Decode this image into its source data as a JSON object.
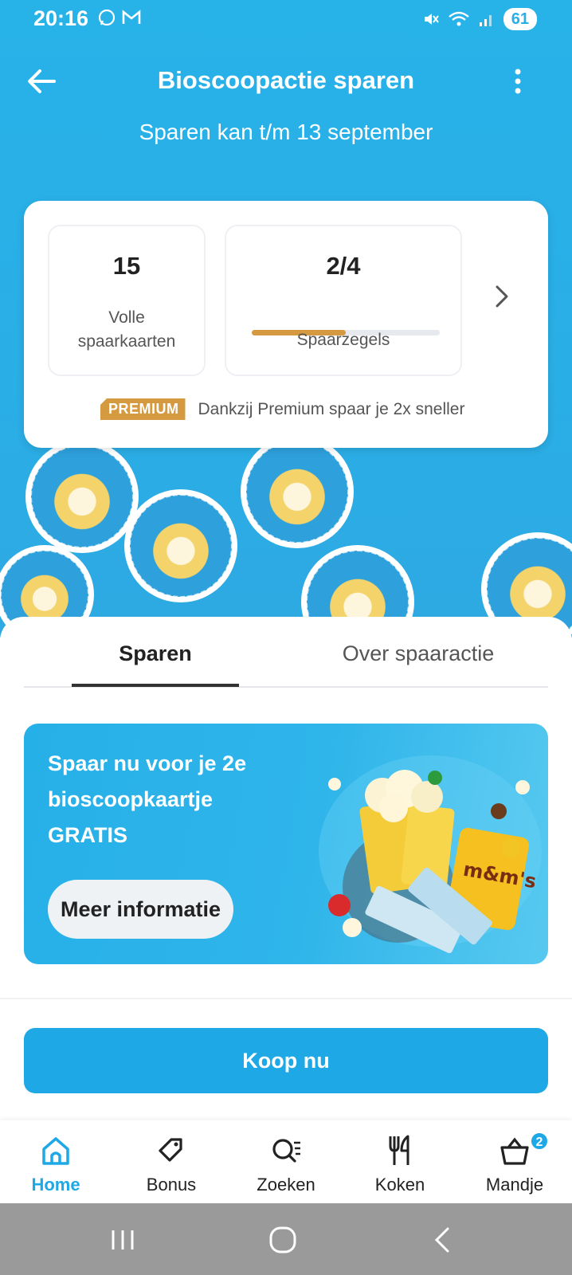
{
  "status_bar": {
    "time": "20:16",
    "battery": "61",
    "icons": [
      "whatsapp-icon",
      "gmail-icon",
      "mute-icon",
      "wifi-icon",
      "signal-icon"
    ]
  },
  "header": {
    "title": "Bioscoopactie sparen",
    "subtitle": "Sparen kan t/m 13 september"
  },
  "summary": {
    "full_cards_count": "15",
    "full_cards_label": "Volle spaarkaarten",
    "stamps_count": "2/4",
    "stamps_progress": 0.5,
    "stamps_label": "Spaarzegels",
    "premium_badge": "PREMIUM",
    "premium_text": "Dankzij Premium spaar je 2x sneller"
  },
  "tabs": [
    {
      "label": "Sparen",
      "active": true
    },
    {
      "label": "Over spaaractie",
      "active": false
    }
  ],
  "promo": {
    "text": "Spaar nu voor je 2e bioscoopkaartje GRATIS",
    "button_label": "Meer informatie"
  },
  "buy_button_label": "Koop nu",
  "bottom_nav": [
    {
      "label": "Home",
      "icon": "home-icon",
      "active": true
    },
    {
      "label": "Bonus",
      "icon": "tag-icon",
      "active": false
    },
    {
      "label": "Zoeken",
      "icon": "search-list-icon",
      "active": false
    },
    {
      "label": "Koken",
      "icon": "cutlery-icon",
      "active": false
    },
    {
      "label": "Mandje",
      "icon": "basket-icon",
      "active": false,
      "badge": "2"
    }
  ],
  "colors": {
    "brand_blue": "#1ea8e6",
    "hero_blue": "#2aaee6",
    "premium_gold": "#d59a3f"
  }
}
